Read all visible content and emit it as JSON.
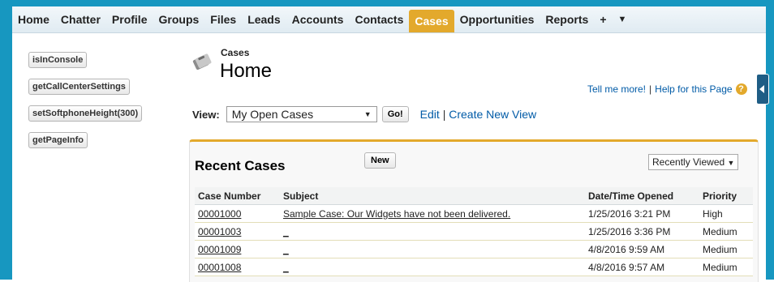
{
  "nav": {
    "tabs": [
      "Home",
      "Chatter",
      "Profile",
      "Groups",
      "Files",
      "Leads",
      "Accounts",
      "Contacts",
      "Cases",
      "Opportunities",
      "Reports"
    ],
    "active": "Cases",
    "plus_label": "+",
    "menu_label": "▼"
  },
  "sidebar": {
    "buttons": [
      "isInConsole",
      "getCallCenterSettings",
      "setSoftphoneHeight(300)",
      "getPageInfo"
    ]
  },
  "header": {
    "page_type": "Cases",
    "title": "Home",
    "tell_me_more": "Tell me more!",
    "help_link": "Help for this Page",
    "help_icon": "?"
  },
  "view": {
    "label": "View:",
    "selected": "My Open Cases",
    "go_label": "Go!",
    "edit_label": "Edit",
    "create_label": "Create New View"
  },
  "recent": {
    "title": "Recent Cases",
    "new_label": "New",
    "filter": "Recently Viewed",
    "columns": [
      "Case Number",
      "Subject",
      "Date/Time Opened",
      "Priority"
    ],
    "rows": [
      {
        "number": "00001000",
        "subject": "Sample Case: Our Widgets have not been delivered.",
        "opened": "1/25/2016 3:21 PM",
        "priority": "High"
      },
      {
        "number": "00001003",
        "subject": "_",
        "opened": "1/25/2016 3:36 PM",
        "priority": "Medium"
      },
      {
        "number": "00001009",
        "subject": "_",
        "opened": "4/8/2016 9:59 AM",
        "priority": "Medium"
      },
      {
        "number": "00001008",
        "subject": "_",
        "opened": "4/8/2016 9:57 AM",
        "priority": "Medium"
      }
    ]
  },
  "colors": {
    "frame": "#1797c0",
    "accent": "#e3a92c",
    "link": "#015ba7"
  }
}
